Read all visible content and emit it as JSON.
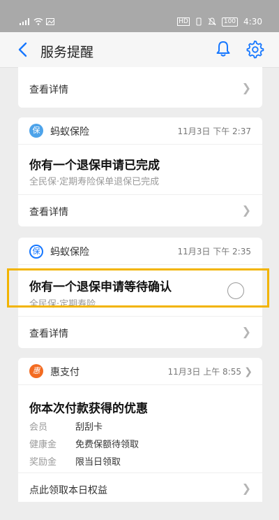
{
  "status": {
    "time": "4:30",
    "battery": "100"
  },
  "nav": {
    "title": "服务提醒"
  },
  "partial_card": {
    "detail_label": "查看详情"
  },
  "card1": {
    "badge": "保",
    "brand": "蚂蚁保险",
    "time": "11月3日 下午 2:37",
    "title": "你有一个退保申请已完成",
    "subtitle": "全民保·定期寿险保单退保已完成",
    "detail_label": "查看详情"
  },
  "card2": {
    "badge": "保",
    "brand": "蚂蚁保险",
    "time": "11月3日 下午 2:35",
    "title": "你有一个退保申请等待确认",
    "subtitle": "全民保·定期寿险",
    "detail_label": "查看详情"
  },
  "card3": {
    "badge": "惠",
    "brand": "惠支付",
    "time": "11月3日 上午 8:55",
    "title": "你本次付款获得的优惠",
    "rows": [
      {
        "key": "会员",
        "value": "刮刮卡"
      },
      {
        "key": "健康金",
        "value": "免费保额待领取"
      },
      {
        "key": "奖励金",
        "value": "限当日领取"
      }
    ],
    "detail_label": "点此领取本日权益"
  },
  "colors": {
    "accent": "#1677ff",
    "highlight": "#f2b400",
    "hui": "#f36b21"
  }
}
